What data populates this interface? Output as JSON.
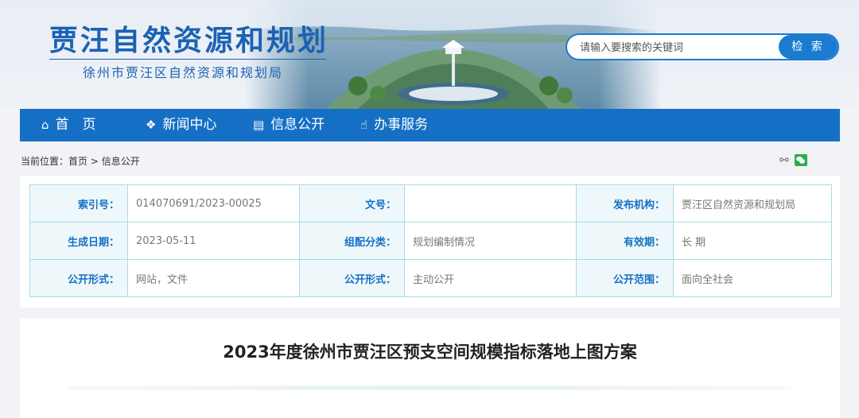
{
  "header": {
    "title": "贾汪自然资源和规划",
    "subtitle": "徐州市贾汪区自然资源和规划局"
  },
  "search": {
    "placeholder": "请输入要搜索的关键词",
    "button_label": "检 索"
  },
  "nav": {
    "items": [
      {
        "label": "首　页",
        "icon": "home-icon"
      },
      {
        "label": "新闻中心",
        "icon": "globe-icon"
      },
      {
        "label": "信息公开",
        "icon": "document-icon"
      },
      {
        "label": "办事服务",
        "icon": "thumbs-up-icon"
      }
    ]
  },
  "breadcrumb": {
    "prefix": "当前位置：",
    "home": "首页",
    "separator": " > ",
    "current": "信息公开"
  },
  "info": {
    "rows": [
      [
        {
          "key": "索引号：",
          "value": "014070691/2023-00025"
        },
        {
          "key": "文号：",
          "value": ""
        },
        {
          "key": "发布机构：",
          "value": "贾汪区自然资源和规划局"
        }
      ],
      [
        {
          "key": "生成日期：",
          "value": "2023-05-11"
        },
        {
          "key": "组配分类：",
          "value": "规划编制情况"
        },
        {
          "key": "有效期：",
          "value": "长 期"
        }
      ],
      [
        {
          "key": "公开形式：",
          "value": "网站，文件"
        },
        {
          "key": "公开形式：",
          "value": "主动公开"
        },
        {
          "key": "公开范围：",
          "value": "面向全社会"
        }
      ]
    ]
  },
  "article": {
    "title": "2023年度徐州市贾汪区预支空间规模指标落地上图方案"
  },
  "colors": {
    "brand": "#1b62b3",
    "nav_bg": "#1570c5",
    "search_accent": "#1b7bd0",
    "table_key_bg": "#eef8fb",
    "table_border": "#a9dbe4",
    "wechat": "#2aae4a"
  }
}
